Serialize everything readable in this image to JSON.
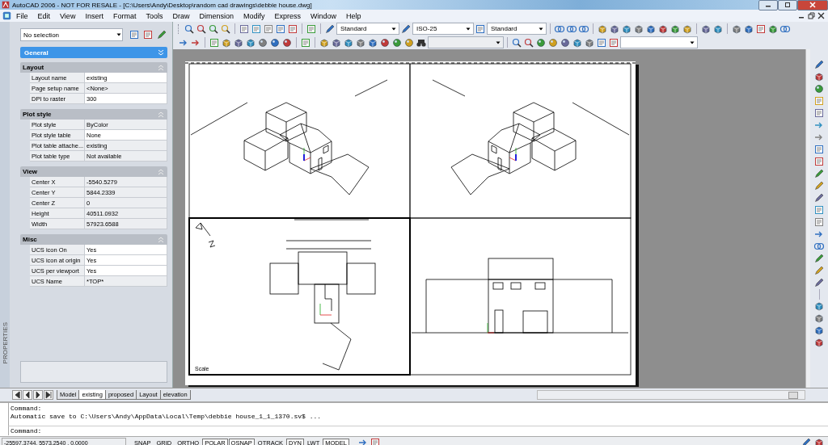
{
  "window": {
    "title": "AutoCAD 2006 - NOT FOR RESALE - [C:\\Users\\Andy\\Desktop\\random cad drawings\\debbie house.dwg]"
  },
  "menu": [
    "File",
    "Edit",
    "View",
    "Insert",
    "Format",
    "Tools",
    "Draw",
    "Dimension",
    "Modify",
    "Express",
    "Window",
    "Help"
  ],
  "properties": {
    "selection": "No selection",
    "header": {
      "label": "General",
      "expanded": false
    },
    "side_label": "PROPERTIES",
    "sections": [
      {
        "title": "Layout",
        "expanded": true,
        "rows": [
          {
            "label": "Layout name",
            "value": "existing",
            "editable": true
          },
          {
            "label": "Page setup name",
            "value": "<None>",
            "editable": false
          },
          {
            "label": "DPI to raster",
            "value": "300",
            "editable": true
          }
        ]
      },
      {
        "title": "Plot style",
        "expanded": true,
        "rows": [
          {
            "label": "Plot style",
            "value": "ByColor",
            "editable": false
          },
          {
            "label": "Plot style table",
            "value": "None",
            "editable": true
          },
          {
            "label": "Plot table attache...",
            "value": "existing",
            "editable": false
          },
          {
            "label": "Plot table type",
            "value": "Not available",
            "editable": false
          }
        ]
      },
      {
        "title": "View",
        "expanded": true,
        "rows": [
          {
            "label": "Center X",
            "value": "-5540.5279",
            "editable": false
          },
          {
            "label": "Center Y",
            "value": "5844.2339",
            "editable": false
          },
          {
            "label": "Center Z",
            "value": "0",
            "editable": false
          },
          {
            "label": "Height",
            "value": "40511.0932",
            "editable": false
          },
          {
            "label": "Width",
            "value": "57923.6588",
            "editable": false
          }
        ]
      },
      {
        "title": "Misc",
        "expanded": true,
        "rows": [
          {
            "label": "UCS icon On",
            "value": "Yes",
            "editable": true
          },
          {
            "label": "UCS icon at origin",
            "value": "Yes",
            "editable": true
          },
          {
            "label": "UCS per viewport",
            "value": "Yes",
            "editable": true
          },
          {
            "label": "UCS Name",
            "value": "*TOP*",
            "editable": false
          }
        ]
      }
    ]
  },
  "toolbars": {
    "text_style": "Standard",
    "dim_style": "ISO-25",
    "table_style": "Standard"
  },
  "drawing": {
    "viewports": [
      {
        "kind": "iso",
        "active": false
      },
      {
        "kind": "iso-mirror",
        "active": false
      },
      {
        "kind": "plan",
        "active": true,
        "label": "Scale"
      },
      {
        "kind": "elevation",
        "active": false
      }
    ]
  },
  "layout_tabs": [
    {
      "label": "Model",
      "selected": false
    },
    {
      "label": "existing",
      "selected": true
    },
    {
      "label": "proposed",
      "selected": false
    },
    {
      "label": "Layout",
      "selected": false
    },
    {
      "label": "elevation",
      "selected": false
    }
  ],
  "command": {
    "history": [
      "Command:",
      "Automatic save to C:\\Users\\Andy\\AppData\\Local\\Temp\\debbie house_1_1_1370.sv$ ..."
    ],
    "prompt": "Command:"
  },
  "status": {
    "coordinates": "-25597.3744, 5573.2540 , 0.0000",
    "toggles": [
      {
        "label": "SNAP",
        "on": false
      },
      {
        "label": "GRID",
        "on": false
      },
      {
        "label": "ORTHO",
        "on": false
      },
      {
        "label": "POLAR",
        "on": true
      },
      {
        "label": "OSNAP",
        "on": true
      },
      {
        "label": "OTRACK",
        "on": false
      },
      {
        "label": "DYN",
        "on": true
      },
      {
        "label": "LWT",
        "on": false
      },
      {
        "label": "MODEL",
        "on": true
      }
    ]
  }
}
